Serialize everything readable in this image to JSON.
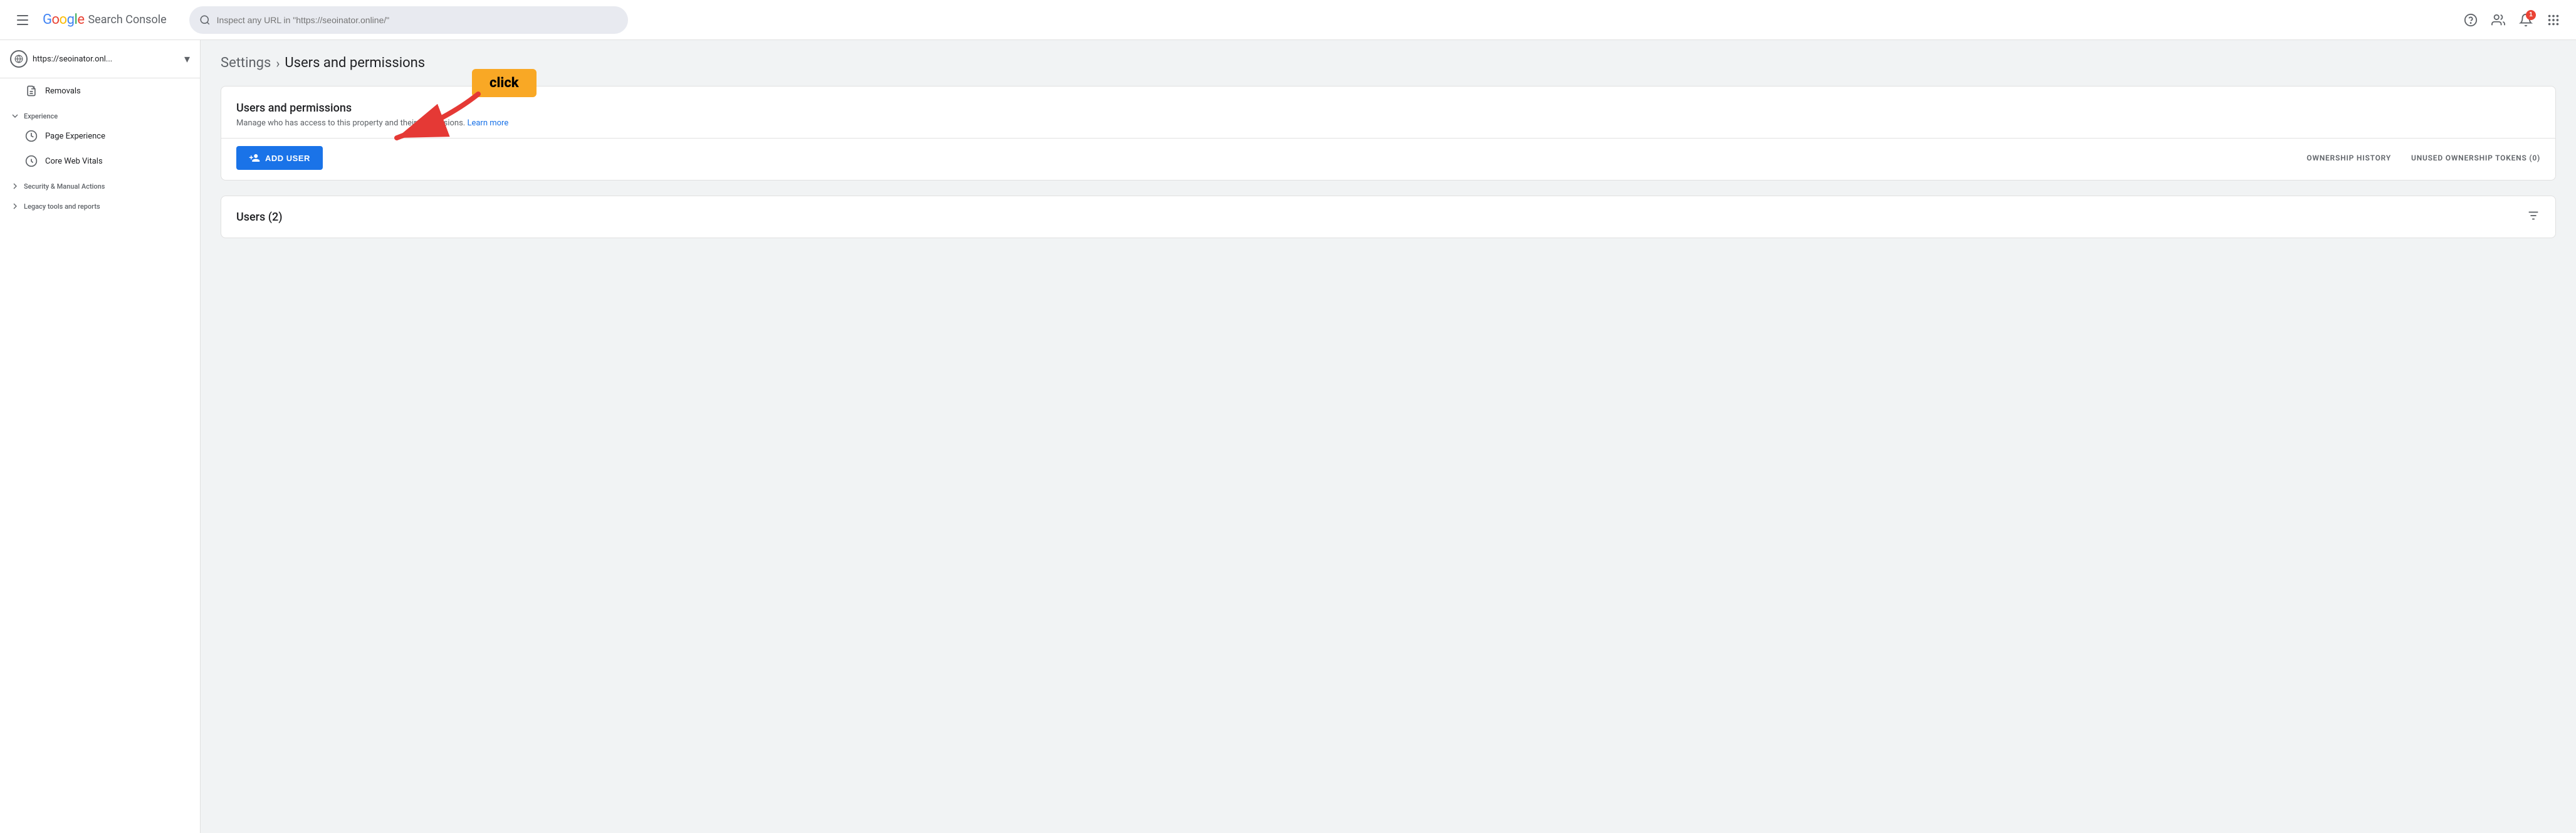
{
  "header": {
    "hamburger_label": "Main menu",
    "logo": {
      "google": "Google",
      "product": "Search Console"
    },
    "search_placeholder": "Inspect any URL in \"https://seoinator.online/\"",
    "nav_icons": {
      "help": "?",
      "user_settings": "👤",
      "notifications": "🔔",
      "notification_count": "1",
      "apps": "⋮⋮⋮"
    }
  },
  "sidebar": {
    "property": {
      "name": "https://seoinator.onl...",
      "icon": "🌐"
    },
    "items": [
      {
        "label": "Removals",
        "icon": "removals-icon",
        "section": "top"
      }
    ],
    "sections": [
      {
        "label": "Experience",
        "expanded": true,
        "items": [
          {
            "label": "Page Experience",
            "icon": "page-experience-icon"
          },
          {
            "label": "Core Web Vitals",
            "icon": "core-web-vitals-icon"
          }
        ]
      },
      {
        "label": "Security & Manual Actions",
        "expanded": false,
        "items": []
      },
      {
        "label": "Legacy tools and reports",
        "expanded": false,
        "items": []
      }
    ]
  },
  "breadcrumb": {
    "settings": "Settings",
    "separator": "›",
    "current": "Users and permissions"
  },
  "permissions_card": {
    "title": "Users and permissions",
    "subtitle": "Manage who has access to this property and their permissions.",
    "learn_more": "Learn more",
    "add_user_label": "ADD USER",
    "ownership_history": "OWNERSHIP HISTORY",
    "unused_tokens": "UNUSED OWNERSHIP TOKENS (0)"
  },
  "users_card": {
    "title": "Users (2)"
  },
  "annotation": {
    "click_label": "click"
  }
}
